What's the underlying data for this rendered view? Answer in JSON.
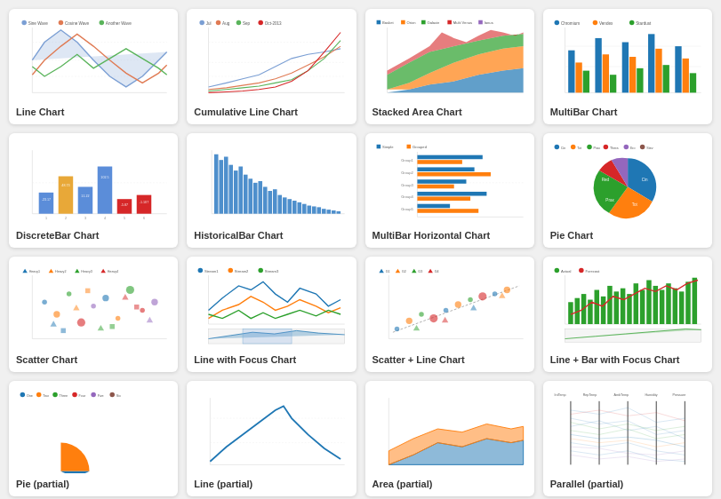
{
  "cards": [
    {
      "id": "line-chart",
      "label": "Line Chart",
      "type": "line"
    },
    {
      "id": "cumulative-line-chart",
      "label": "Cumulative Line Chart",
      "type": "cumulative"
    },
    {
      "id": "stacked-area-chart",
      "label": "Stacked Area Chart",
      "type": "stacked-area"
    },
    {
      "id": "multibar-chart",
      "label": "MultiBar Chart",
      "type": "multibar"
    },
    {
      "id": "discretebar-chart",
      "label": "DiscreteBar Chart",
      "type": "discretebar"
    },
    {
      "id": "historicalbar-chart",
      "label": "HistoricalBar Chart",
      "type": "historicalbar"
    },
    {
      "id": "multibar-horizontal-chart",
      "label": "MultiBar Horizontal Chart",
      "type": "multibar-horizontal"
    },
    {
      "id": "pie-chart",
      "label": "Pie Chart",
      "type": "pie"
    },
    {
      "id": "scatter-chart",
      "label": "Scatter Chart",
      "type": "scatter"
    },
    {
      "id": "line-focus-chart",
      "label": "Line with Focus Chart",
      "type": "line-focus"
    },
    {
      "id": "scatter-line-chart",
      "label": "Scatter + Line Chart",
      "type": "scatter-line"
    },
    {
      "id": "line-bar-focus-chart",
      "label": "Line + Bar with Focus Chart",
      "type": "line-bar-focus"
    },
    {
      "id": "partial1",
      "label": "Pie (partial)",
      "type": "pie-partial"
    },
    {
      "id": "partial2",
      "label": "Line (partial)",
      "type": "line-partial"
    },
    {
      "id": "partial3",
      "label": "Area (partial)",
      "type": "area-partial"
    },
    {
      "id": "partial4",
      "label": "Parallel (partial)",
      "type": "parallel-partial"
    }
  ]
}
